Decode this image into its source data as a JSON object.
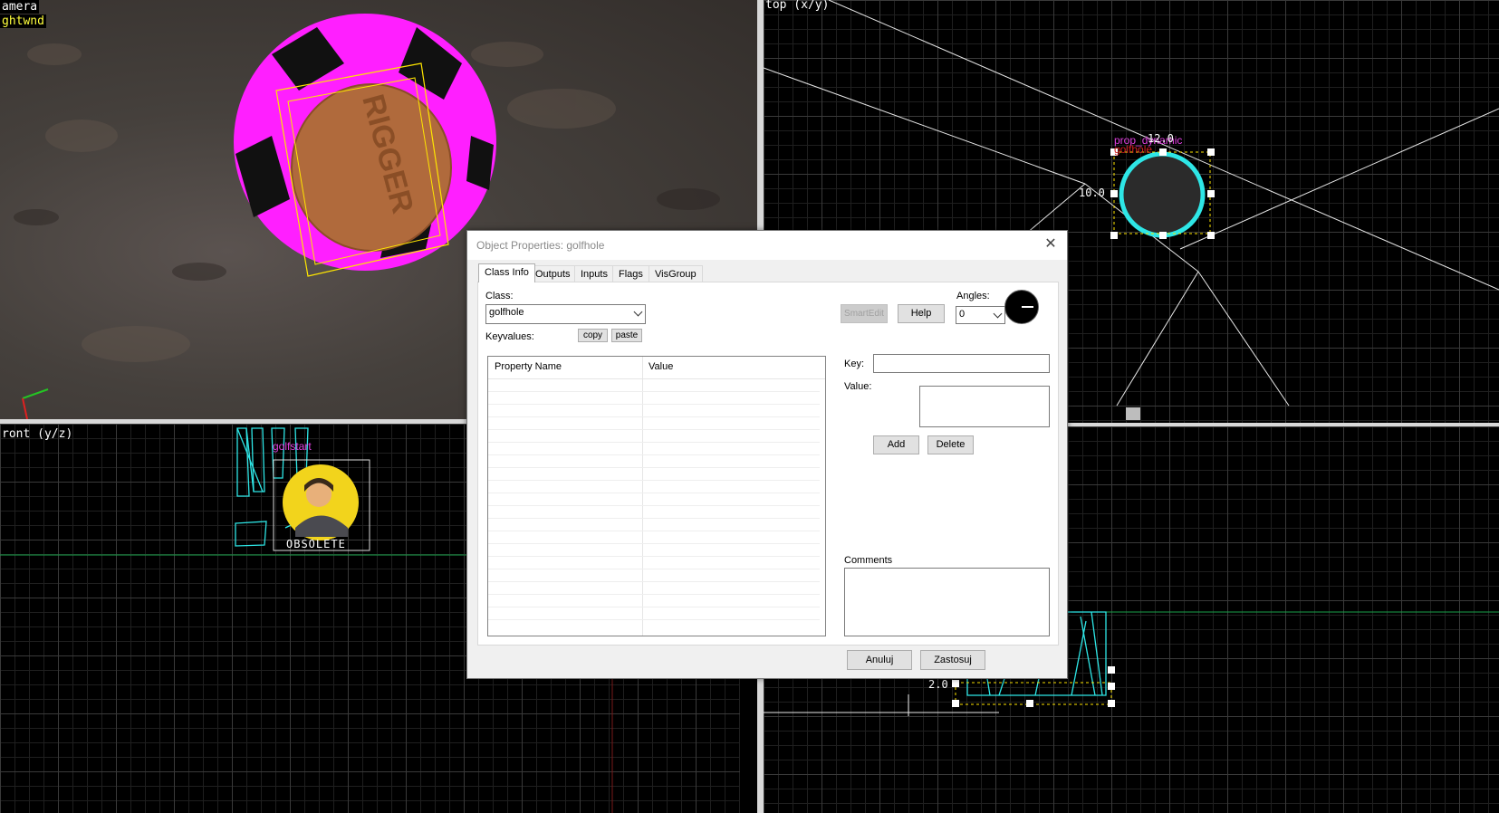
{
  "viewports": {
    "camera": {
      "label": "amera",
      "label2": "ghtwnd"
    },
    "top": {
      "label": "top (x/y)",
      "entity_label": "prop_dynamic",
      "entity_label2": "golfhole",
      "dim_width": "12.0",
      "dim_height": "10.0"
    },
    "front": {
      "label": "ront (y/z)",
      "entity_label": "golfstart",
      "obsolete_text": "OBSOLETE"
    },
    "side": {
      "dim_height": "2.0"
    }
  },
  "dialog": {
    "title": "Object Properties: golfhole",
    "close": "✕",
    "tabs": [
      "Class Info",
      "Outputs",
      "Inputs",
      "Flags",
      "VisGroup"
    ],
    "class_label": "Class:",
    "class_value": "golfhole",
    "keyvalues_label": "Keyvalues:",
    "copy_label": "copy",
    "paste_label": "paste",
    "smartedit_label": "SmartEdit",
    "help_label": "Help",
    "angles_label": "Angles:",
    "angles_value": "0",
    "property_name_header": "Property Name",
    "value_header": "Value",
    "key_label": "Key:",
    "value_label": "Value:",
    "add_label": "Add",
    "delete_label": "Delete",
    "comments_label": "Comments",
    "cancel_label": "Anuluj",
    "apply_label": "Zastosuj"
  },
  "colors": {
    "accent_magenta": "#ff00ff",
    "cyan": "#2ee6e6",
    "yellow": "#ffff3c"
  }
}
